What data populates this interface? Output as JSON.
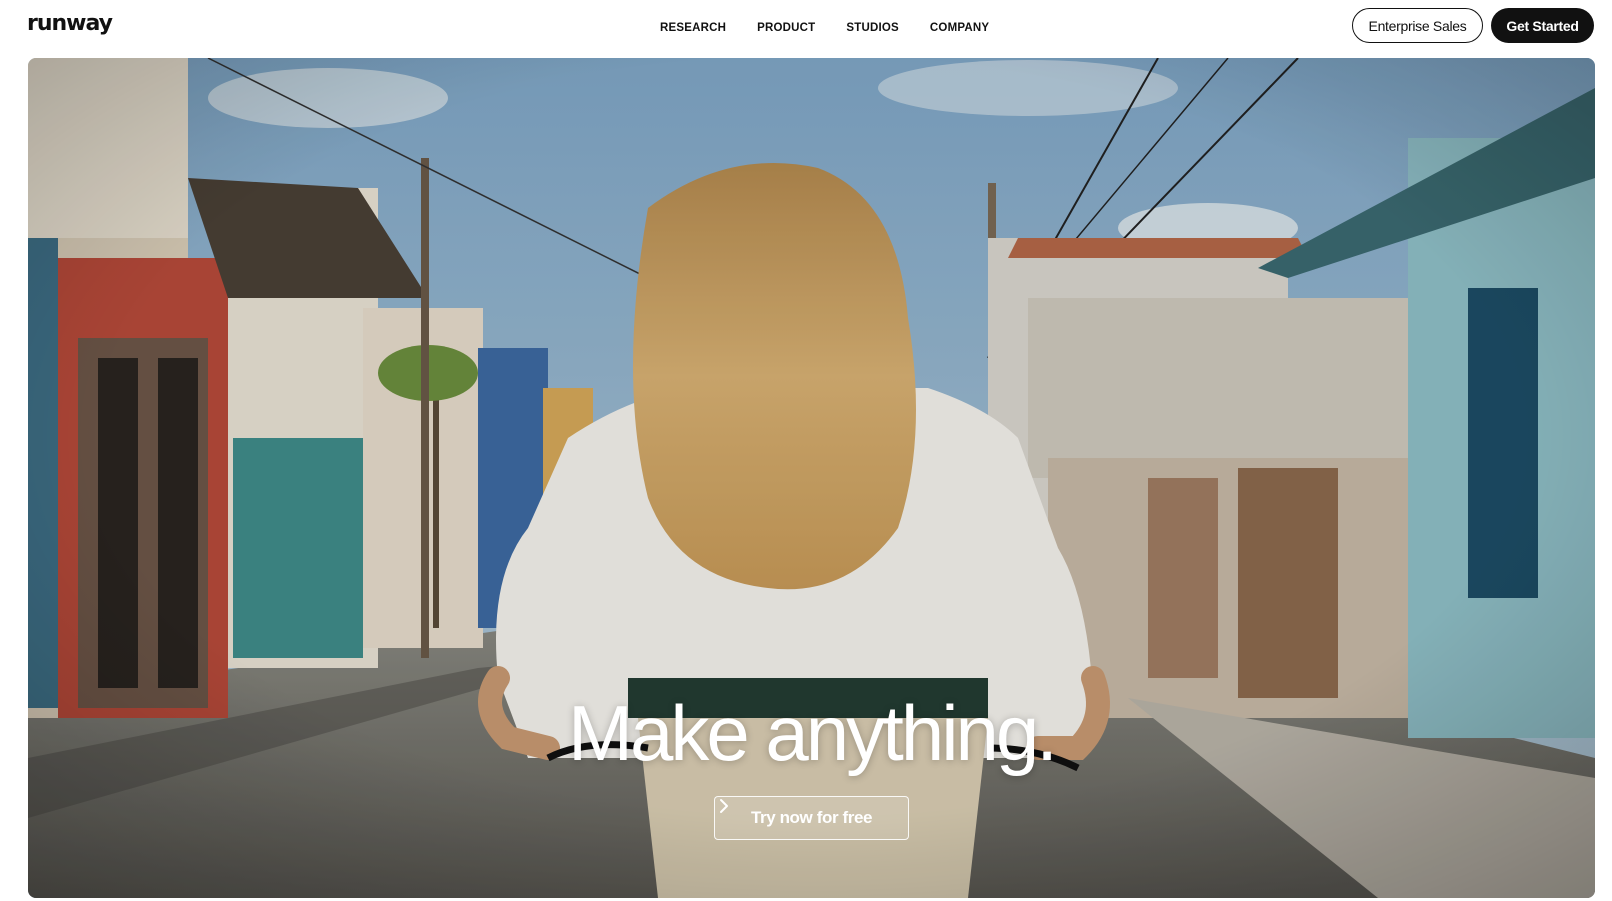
{
  "brand": {
    "logo_text": "runway"
  },
  "nav": {
    "items": [
      {
        "label": "RESEARCH"
      },
      {
        "label": "PRODUCT"
      },
      {
        "label": "STUDIOS"
      },
      {
        "label": "COMPANY"
      }
    ]
  },
  "header_actions": {
    "enterprise_label": "Enterprise Sales",
    "get_started_label": "Get Started"
  },
  "hero": {
    "headline": "Make anything.",
    "cta_label": "Try now for free",
    "cta_icon": "chevron-right-icon"
  },
  "colors": {
    "text": "#111111",
    "button_dark": "#111111",
    "hero_text": "#ffffff"
  }
}
